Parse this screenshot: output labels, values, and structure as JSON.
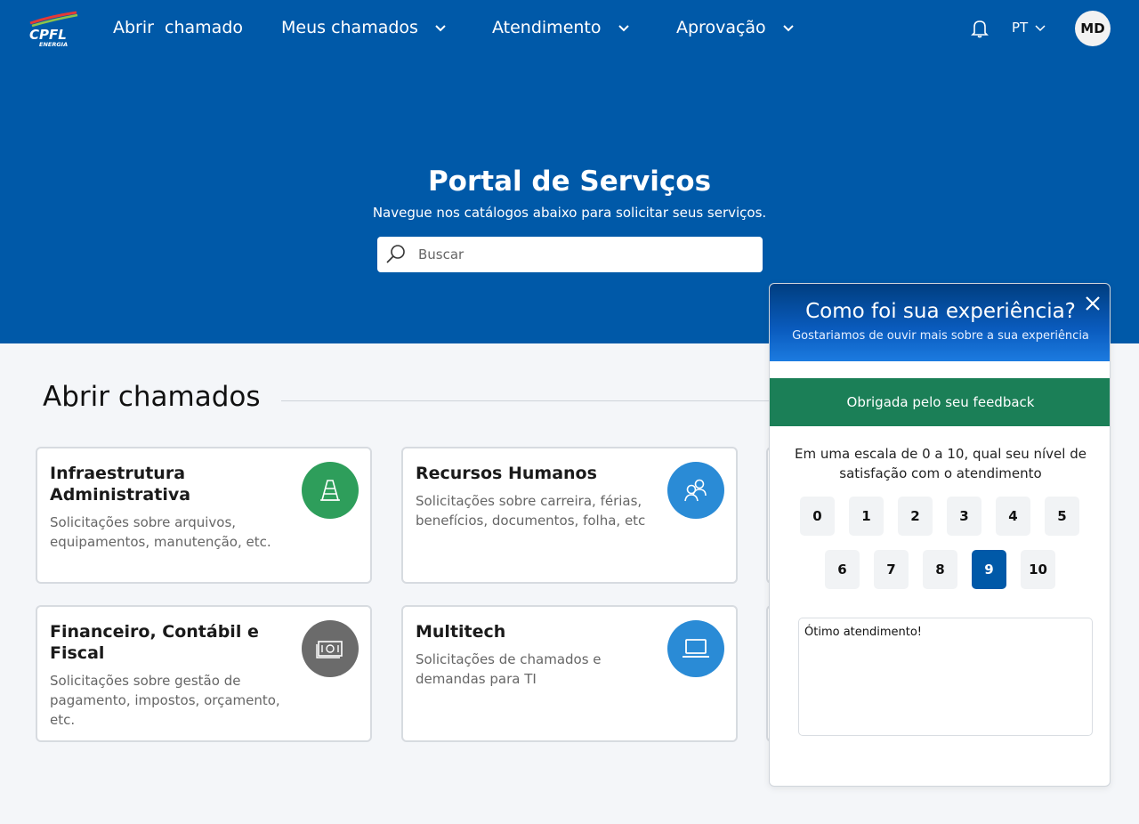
{
  "header": {
    "logo_text": "CPFL",
    "logo_subtext": "ENERGIA",
    "nav": [
      {
        "label": "Abrir  chamado"
      },
      {
        "label": "Meus chamados"
      },
      {
        "label": "Atendimento"
      },
      {
        "label": "Aprovação"
      }
    ],
    "language": "PT",
    "avatar_initials": "MD"
  },
  "hero": {
    "title": "Portal de Serviços",
    "subtitle": "Navegue nos catálogos abaixo para solicitar seus serviços.",
    "search_placeholder": "Buscar"
  },
  "section": {
    "title": "Abrir chamados"
  },
  "cards": [
    {
      "title": "Infraestrutura Administrativa",
      "description": "Solicitações sobre arquivos, equipamentos, manutenção, etc.",
      "icon": "road-cone-icon",
      "color": "#2e9e5b"
    },
    {
      "title": "Recursos Humanos",
      "description": "Solicitações sobre carreira, férias, benefícios, documentos, folha, etc",
      "icon": "people-icon",
      "color": "#2a8bd6"
    },
    {
      "title": "Financeiro, Contábil e Fiscal",
      "description": "Solicitações sobre gestão de pagamento, impostos, orçamento, etc.",
      "icon": "money-icon",
      "color": "#6b6b6b"
    },
    {
      "title": "Multitech",
      "description": "Solicitações de chamados e demandas para TI",
      "icon": "laptop-icon",
      "color": "#2a8bd6"
    }
  ],
  "feedback": {
    "title": "Como foi sua experiência?",
    "subtitle": "Gostariamos de ouvir mais sobre a sua experiência",
    "thanks_message": "Obrigada pelo seu feedback",
    "question": "Em uma escala de 0 a 10, qual seu nível de satisfação com o atendimento",
    "scores": [
      "0",
      "1",
      "2",
      "3",
      "4",
      "5",
      "6",
      "7",
      "8",
      "9",
      "10"
    ],
    "selected_score": "9",
    "comment": "Ótimo atendimento!",
    "colors": {
      "selected": "#0059a8",
      "thanks_bg": "#1b7f57"
    }
  }
}
